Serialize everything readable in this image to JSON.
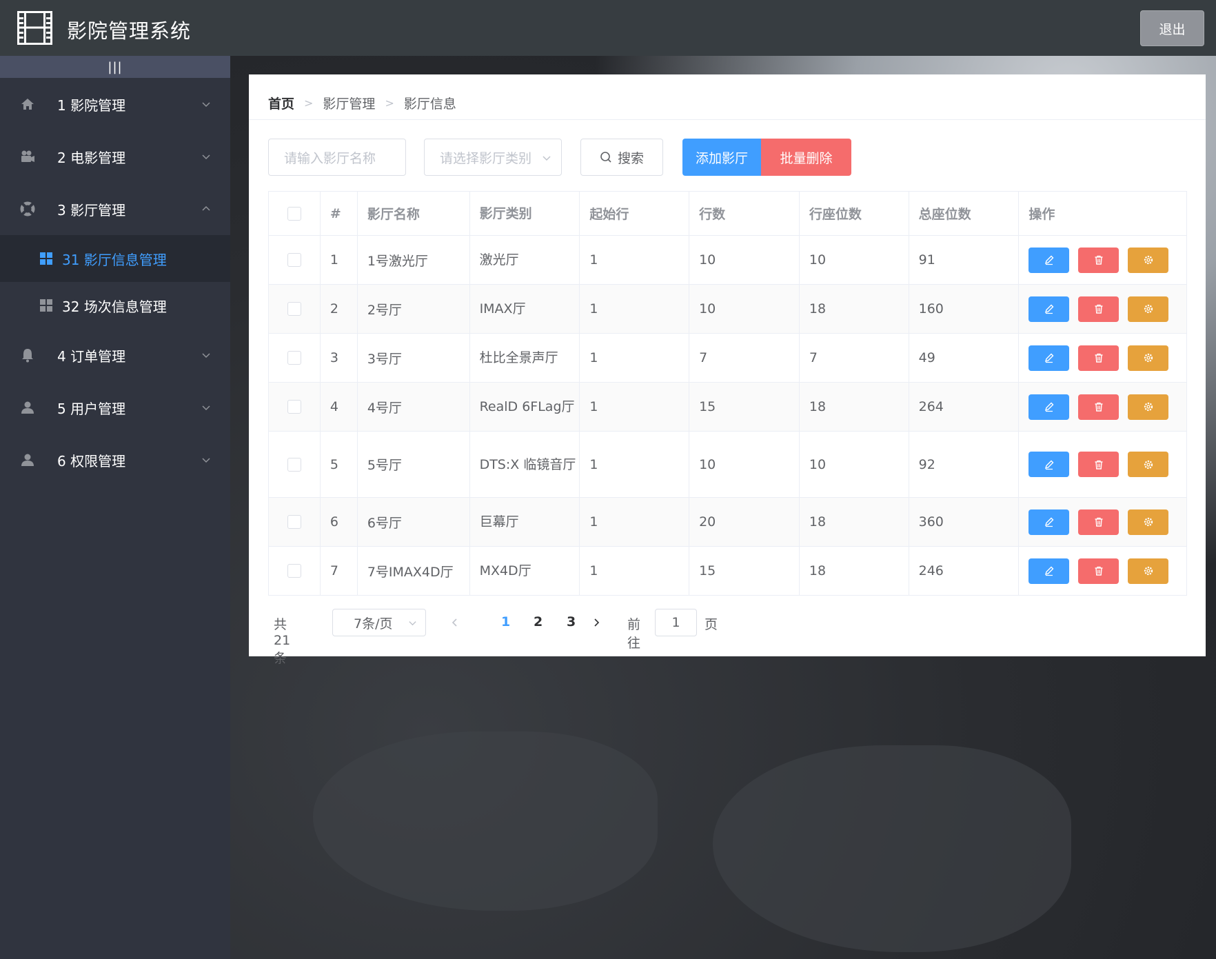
{
  "header": {
    "title": "影院管理系统",
    "logout_label": "退出"
  },
  "sidebar": {
    "collapse_label": "|||",
    "menus": [
      {
        "label": "1 影院管理",
        "icon": "home-icon"
      },
      {
        "label": "2 电影管理",
        "icon": "camera-icon"
      },
      {
        "label": "3 影厅管理",
        "icon": "lifebuoy-icon",
        "open": true,
        "children": [
          {
            "label": "31 影厅信息管理",
            "active": true
          },
          {
            "label": "32 场次信息管理"
          }
        ]
      },
      {
        "label": "4 订单管理",
        "icon": "bell-icon"
      },
      {
        "label": "5 用户管理",
        "icon": "user-icon"
      },
      {
        "label": "6 权限管理",
        "icon": "user-icon"
      }
    ]
  },
  "breadcrumb": [
    "首页",
    "影厅管理",
    "影厅信息"
  ],
  "toolbar": {
    "name_placeholder": "请输入影厅名称",
    "type_placeholder": "请选择影厅类别",
    "search_label": "搜索",
    "add_label": "添加影厅",
    "bulk_delete_label": "批量删除"
  },
  "table": {
    "columns": [
      "#",
      "影厅名称",
      "影厅类别",
      "起始行",
      "行数",
      "行座位数",
      "总座位数",
      "操作"
    ],
    "rows": [
      {
        "index": "1",
        "name": "1号激光厅",
        "type": "激光厅",
        "start_row": "1",
        "rows": "10",
        "seats_per_row": "10",
        "total_seats": "91"
      },
      {
        "index": "2",
        "name": "2号厅",
        "type": "IMAX厅",
        "start_row": "1",
        "rows": "10",
        "seats_per_row": "18",
        "total_seats": "160"
      },
      {
        "index": "3",
        "name": "3号厅",
        "type": "杜比全景声厅",
        "start_row": "1",
        "rows": "7",
        "seats_per_row": "7",
        "total_seats": "49"
      },
      {
        "index": "4",
        "name": "4号厅",
        "type": "RealD 6FLag厅",
        "start_row": "1",
        "rows": "15",
        "seats_per_row": "18",
        "total_seats": "264"
      },
      {
        "index": "5",
        "name": "5号厅",
        "type": "DTS:X 临镜音厅",
        "start_row": "1",
        "rows": "10",
        "seats_per_row": "10",
        "total_seats": "92"
      },
      {
        "index": "6",
        "name": "6号厅",
        "type": "巨幕厅",
        "start_row": "1",
        "rows": "20",
        "seats_per_row": "18",
        "total_seats": "360"
      },
      {
        "index": "7",
        "name": "7号IMAX4D厅",
        "type": "MX4D厅",
        "start_row": "1",
        "rows": "15",
        "seats_per_row": "18",
        "total_seats": "246"
      }
    ]
  },
  "pagination": {
    "total_text": "共 21 条",
    "page_size_label": "7条/页",
    "pages": [
      "1",
      "2",
      "3"
    ],
    "current_page": "1",
    "goto_label": "前往",
    "goto_value": "1",
    "page_suffix": "页"
  },
  "colors": {
    "primary": "#409eff",
    "danger": "#f56c6c",
    "warning": "#e6a23c",
    "header_bg": "#373d41",
    "sidebar_bg": "#30343f"
  }
}
